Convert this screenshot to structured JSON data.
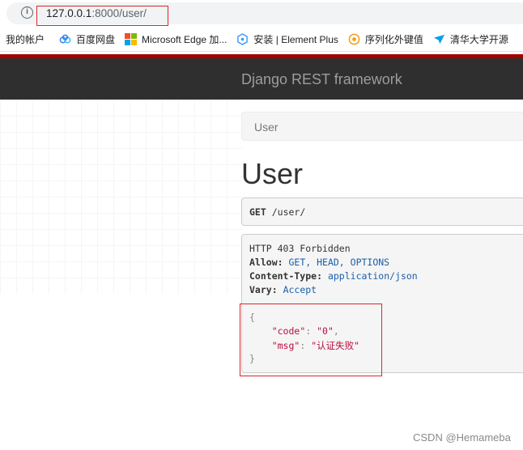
{
  "address_bar": {
    "info_icon": "info-icon",
    "url_host": "127.0.0.1",
    "url_rest": ":8000/user/"
  },
  "bookmarks": [
    {
      "label": "我的帐户",
      "icon": "none"
    },
    {
      "label": "百度网盘",
      "icon": "cloud-icon",
      "color": "#2f7bf5"
    },
    {
      "label": "Microsoft Edge 加...",
      "icon": "microsoft-logo-icon"
    },
    {
      "label": "安装 | Element Plus",
      "icon": "element-plus-icon",
      "color": "#409eff"
    },
    {
      "label": "序列化外键值",
      "icon": "orange-circle-icon",
      "color": "#f39c12"
    },
    {
      "label": "清华大学开源",
      "icon": "bird-icon",
      "color": "#00a0e9"
    }
  ],
  "navbar": {
    "brand": "Django REST framework",
    "accent_color": "#a30000",
    "background": "#2f2f2f"
  },
  "breadcrumb": {
    "label": "User"
  },
  "page": {
    "title": "User"
  },
  "request": {
    "method": "GET",
    "path": "/user/"
  },
  "response": {
    "status_line": "HTTP 403 Forbidden",
    "allow_label": "Allow:",
    "allow_value": "GET, HEAD, OPTIONS",
    "content_type_label": "Content-Type:",
    "content_type_value": "application/json",
    "vary_label": "Vary:",
    "vary_value": "Accept",
    "json": {
      "open": "{",
      "code_key": "\"code\"",
      "code_value": "\"0\"",
      "msg_key": "\"msg\"",
      "msg_value": "\"认证失败\"",
      "close": "}"
    }
  },
  "watermark": "CSDN @Hemameba",
  "colors": {
    "highlight_border": "#d9262c",
    "json_string": "#b80d3c",
    "header_value": "#1a5fa8"
  }
}
